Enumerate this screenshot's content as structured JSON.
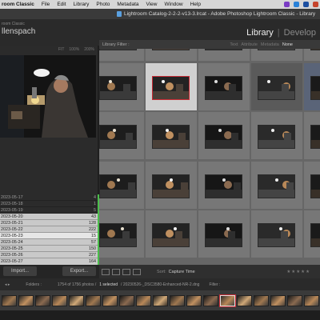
{
  "menubar": {
    "app": "room Classic",
    "items": [
      "File",
      "Edit",
      "Library",
      "Photo",
      "Metadata",
      "View",
      "Window",
      "Help"
    ]
  },
  "window": {
    "title": "Lightroom Catalog-2-2-2-v13-3.lrcat - Adobe Photoshop Lightroom Classic - Library"
  },
  "identity": {
    "line1": "room Classic",
    "line2": "llenspach"
  },
  "modules": {
    "active": "Library",
    "next": "Develop",
    "separator": "|"
  },
  "navigator": {
    "options": [
      "FIT",
      "100%",
      "200%"
    ]
  },
  "dates": [
    {
      "label": "2023-05-17",
      "count": "4"
    },
    {
      "label": "2023-05-18",
      "count": "1"
    },
    {
      "label": "2023-05-19",
      "count": "5"
    },
    {
      "label": "2023-05-20",
      "count": "43"
    },
    {
      "label": "2023-05-21",
      "count": "128"
    },
    {
      "label": "2023-05-22",
      "count": "222"
    },
    {
      "label": "2023-05-23",
      "count": "15"
    },
    {
      "label": "2023-05-24",
      "count": "57"
    },
    {
      "label": "2023-05-25",
      "count": "150"
    },
    {
      "label": "2023-05-26",
      "count": "227"
    },
    {
      "label": "2023-05-27",
      "count": "164"
    },
    {
      "label": "2023-05-28",
      "count": "234"
    },
    {
      "label": "2023-05-29",
      "count": "160"
    },
    {
      "label": "2023-05-30",
      "count": "193"
    },
    {
      "label": "2023-06-01",
      "count": "9"
    },
    {
      "label": "2023-06-02",
      "count": "65"
    },
    {
      "label": "2023-06-03",
      "count": "12"
    }
  ],
  "left_buttons": {
    "import": "Import...",
    "export": "Export..."
  },
  "filter_bar": {
    "title": "Library Filter :",
    "tabs": [
      "Text",
      "Attribute",
      "Metadata",
      "None"
    ],
    "active_tab": "None"
  },
  "toolbar": {
    "sort_label": "Sort:",
    "sort_value": "Capture Time",
    "stars": "★★★★★"
  },
  "filmstrip_header": {
    "folder": "Folders :",
    "count_prefix": "1754 of 1756 photos /",
    "selected": "1 selected",
    "path": "/ 20230526-_DSC3580-Enhanced-NR-2.dng",
    "filter": "Filter :"
  },
  "colors": {
    "accent_green": "#4bbf4b",
    "selection_red": "#c62b34",
    "grid_bg": "#666666"
  }
}
